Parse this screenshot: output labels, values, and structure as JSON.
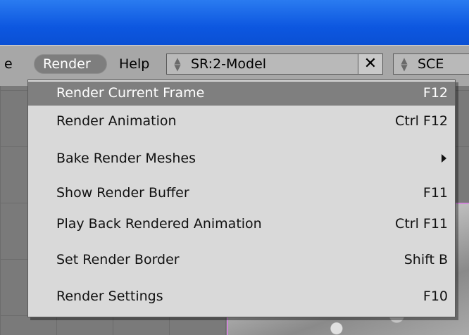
{
  "menubar": {
    "partial_left": "e",
    "render_label": "Render",
    "help_label": "Help",
    "screen_value": "SR:2-Model",
    "delete_label": "✕",
    "scene_value": "SCE"
  },
  "render_menu": {
    "items": [
      {
        "label": "Render Current Frame",
        "shortcut": "F12",
        "selected": true
      },
      {
        "label": "Render Animation",
        "shortcut": "Ctrl F12"
      },
      {
        "label": "Bake Render Meshes",
        "shortcut": "",
        "submenu": true
      },
      {
        "label": "Show Render Buffer",
        "shortcut": "F11"
      },
      {
        "label": "Play Back Rendered Animation",
        "shortcut": "Ctrl F11"
      },
      {
        "label": "Set Render Border",
        "shortcut": "Shift B"
      },
      {
        "label": "Render Settings",
        "shortcut": "F10"
      }
    ]
  },
  "icons": {
    "spinner": "up-down-arrows-icon",
    "delete": "close-icon",
    "submenu": "triangle-right-icon"
  },
  "colors": {
    "titlebar": "#0d57e0",
    "menu_bg": "#d9d9d9",
    "highlight": "#7f7f7f",
    "border_purple": "#d08ad8"
  }
}
